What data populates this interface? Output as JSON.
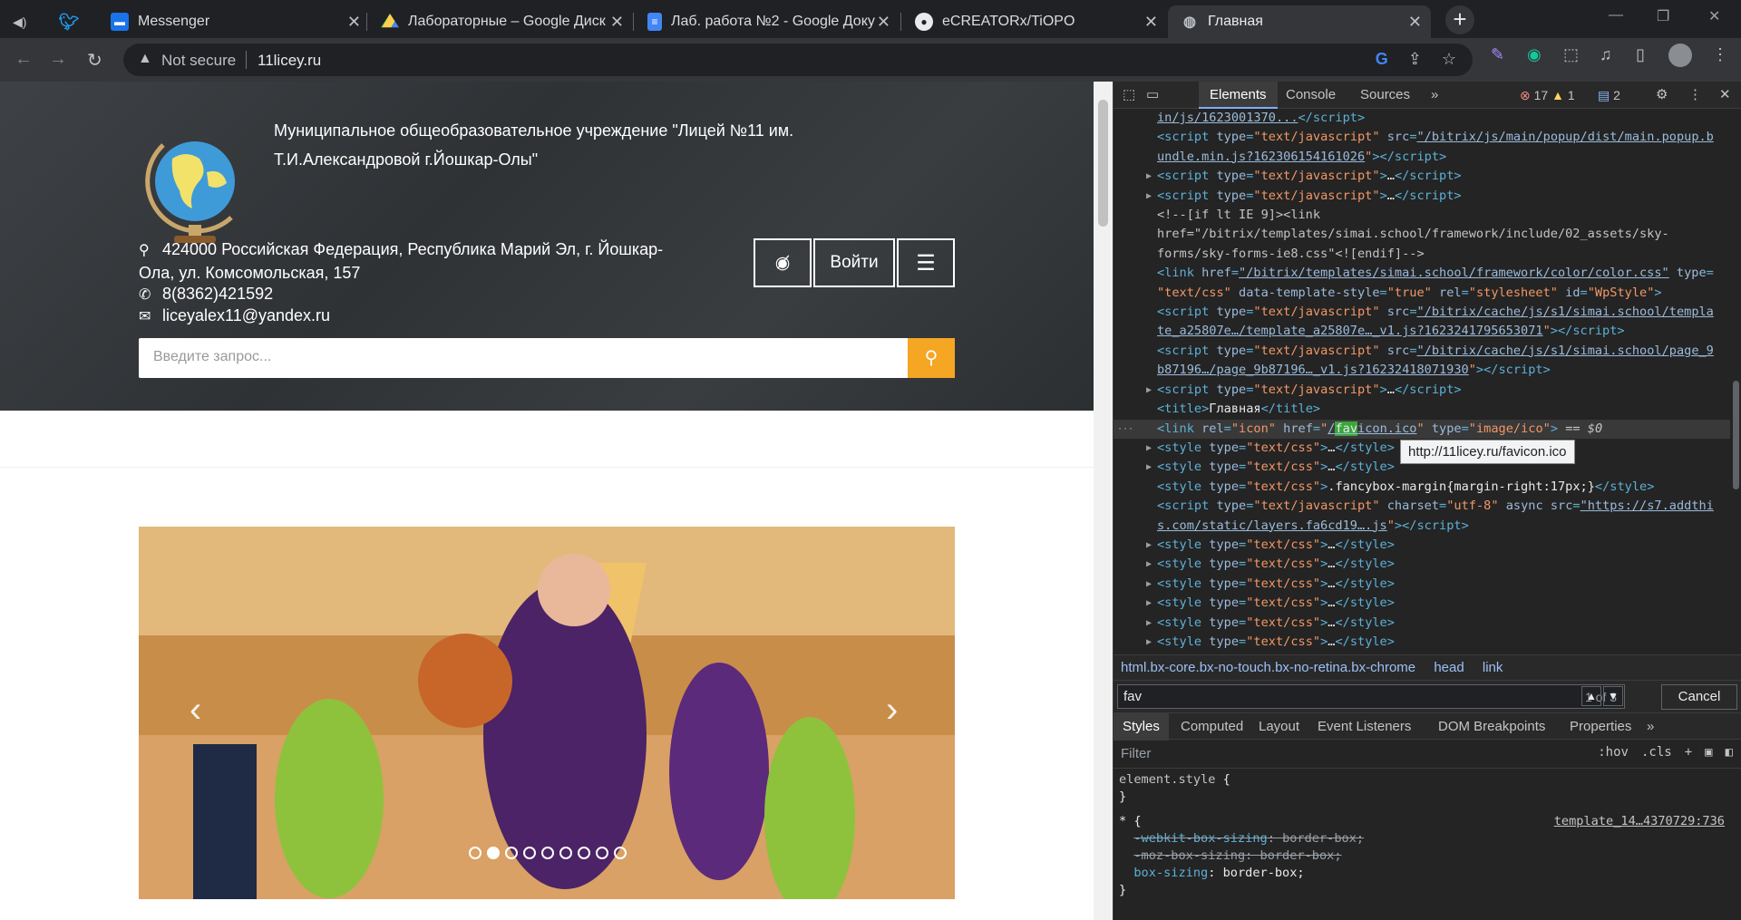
{
  "browser": {
    "tabs": [
      {
        "title": "",
        "icon": "speaker-icon"
      },
      {
        "title": "",
        "icon": "twitter-icon"
      },
      {
        "title": "Messenger",
        "icon": "messenger-icon"
      },
      {
        "title": "Лабораторные – Google Диск",
        "icon": "google-drive-icon"
      },
      {
        "title": "Лаб. работа №2 - Google Доку",
        "icon": "google-docs-icon"
      },
      {
        "title": "eCREATORx/TiOPO",
        "icon": "github-icon"
      },
      {
        "title": "Главная",
        "icon": "globe-icon"
      }
    ],
    "security_label": "Not secure",
    "url": "11licey.ru"
  },
  "site": {
    "school_name": "Муниципальное общеобразовательное учреждение \"Лицей №11 им. Т.И.Александровой г.Йошкар-Олы\"",
    "address": "424000 Российская Федерация, Республика Марий Эл, г. Йошкар-Ола, ул. Комсомольская, 157",
    "phone": "8(8362)421592",
    "email": "liceyalex11@yandex.ru",
    "login_label": "Войти",
    "search_placeholder": "Введите запрос...",
    "slider_dots": 9,
    "slider_active_dot": 2
  },
  "devtools": {
    "tabs": [
      "Elements",
      "Console",
      "Sources",
      "»"
    ],
    "errors": "17",
    "warnings": "1",
    "messages": "2",
    "tooltip": "http://11licey.ru/favicon.ico",
    "breadcrumbs": [
      "html.bx-core.bx-no-touch.bx-no-retina.bx-chrome",
      "head",
      "link"
    ],
    "find_query": "fav",
    "find_count": "1 of 3",
    "cancel_label": "Cancel",
    "style_tabs": [
      "Styles",
      "Computed",
      "Layout",
      "Event Listeners",
      "DOM Breakpoints",
      "Properties",
      "»"
    ],
    "filter_placeholder": "Filter",
    "hov_label": ":hov",
    "cls_label": ".cls",
    "style_source": "template_14…4370729:736"
  },
  "colors": {
    "accent": "#f5a623",
    "devtools_bg": "#242424",
    "chrome_bg": "#202124"
  }
}
